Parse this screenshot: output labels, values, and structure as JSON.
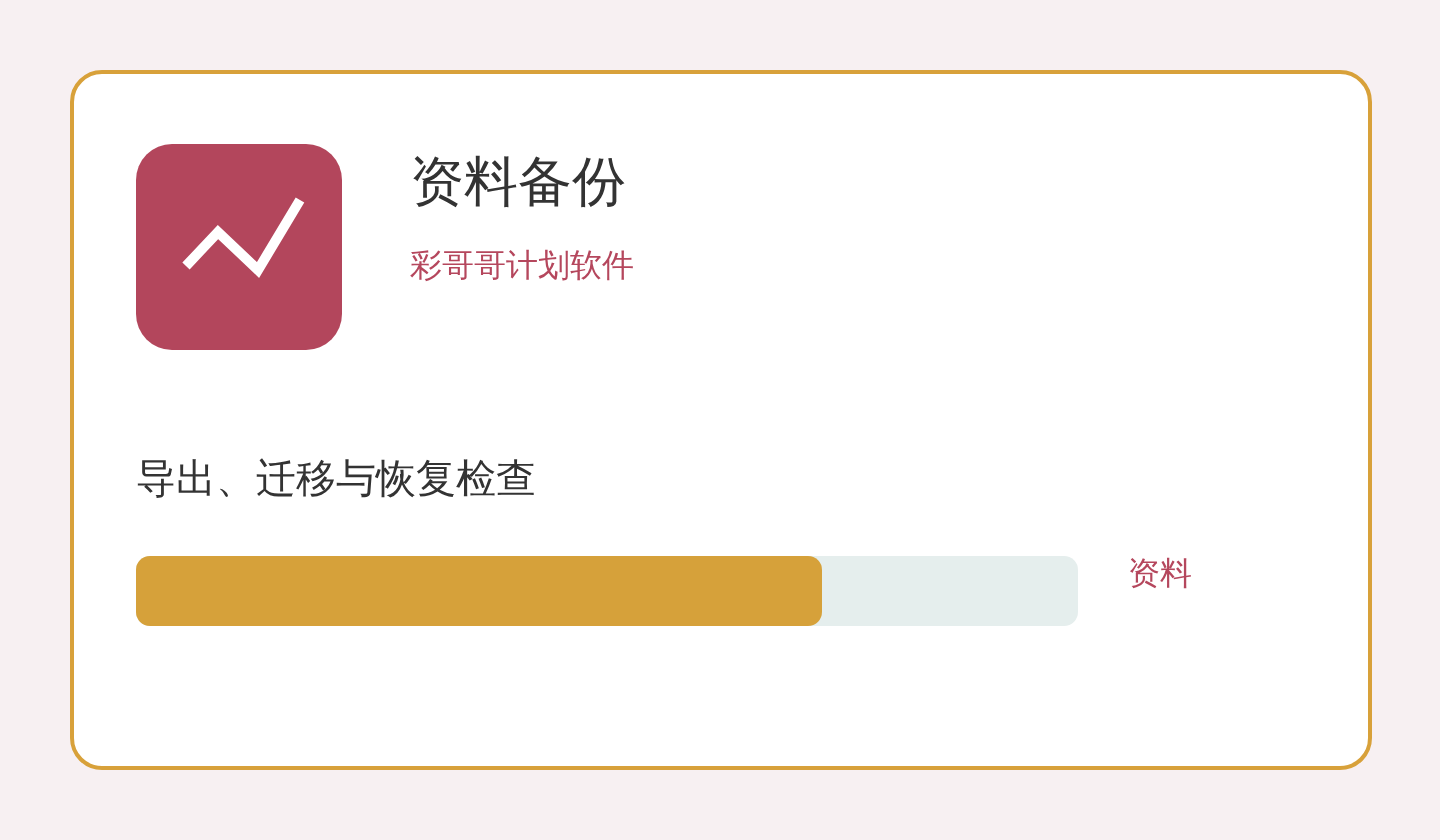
{
  "card": {
    "title": "资料备份",
    "subtitle": "彩哥哥计划软件",
    "description": "导出、迁移与恢复检查",
    "progress": {
      "level": 0.728,
      "label": "资料"
    }
  }
}
